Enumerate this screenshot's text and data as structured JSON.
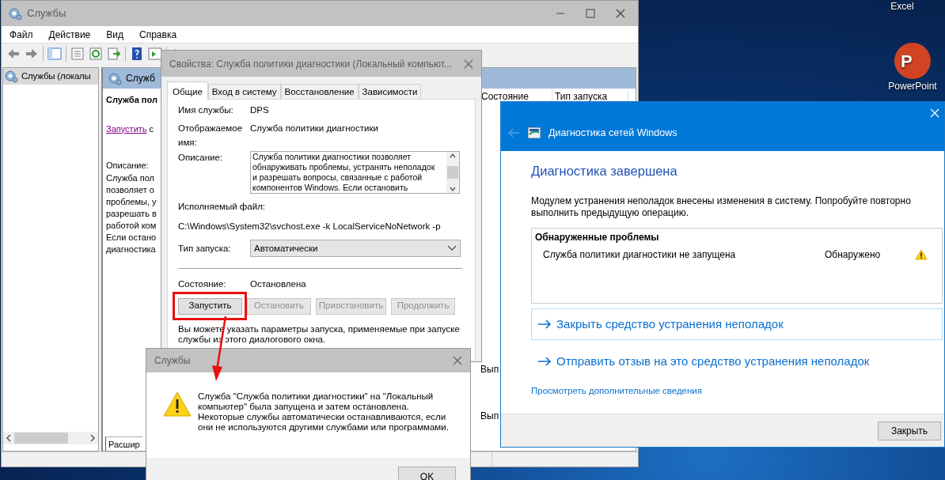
{
  "desktop": {
    "icons": [
      {
        "label": "Excel"
      },
      {
        "label": "PowerPoint",
        "logo_letter": "P"
      }
    ]
  },
  "services": {
    "title": "Службы",
    "menu": [
      "Файл",
      "Действие",
      "Вид",
      "Справка"
    ],
    "tree": [
      {
        "label": "Службы (локалы",
        "selected": true
      }
    ],
    "pane_header": "Служб",
    "service_title": "Служба пол",
    "start_link": "Запустить",
    "start_rest": "с",
    "description_label": "Описание:",
    "description_lines": [
      "Служба пол",
      "позволяет о",
      "проблемы, у",
      "разрешать в",
      "работой ком",
      "Если остано",
      "диагностика"
    ],
    "columns": [
      "Состояние",
      "Тип запуска"
    ],
    "status_cells": [
      "Вып",
      "Вып"
    ],
    "bottom_tab": "Расшир"
  },
  "properties": {
    "title": "Свойства: Служба политики диагностики (Локальный компьют...",
    "tabs": [
      {
        "label": "Общие",
        "selected": true
      },
      {
        "label": "Вход в систему",
        "selected": false
      },
      {
        "label": "Восстановление",
        "selected": false
      },
      {
        "label": "Зависимости",
        "selected": false
      }
    ],
    "service_name_label": "Имя службы:",
    "service_name": "DPS",
    "display_name_label": "Отображаемое имя:",
    "display_name": "Служба политики диагностики",
    "description_label": "Описание:",
    "description_lines": [
      "Служба политики диагностики позволяет",
      "обнаруживать проблемы, устранять неполадок",
      "и разрешать вопросы, связанные с работой",
      "компонентов Windows.  Если остановить"
    ],
    "executable_label": "Исполняемый файл:",
    "executable_path": "C:\\Windows\\System32\\svchost.exe -k LocalServiceNoNetwork -p",
    "startup_label": "Тип запуска:",
    "startup_value": "Автоматически",
    "status_label": "Состояние:",
    "status_value": "Остановлена",
    "buttons": [
      {
        "label": "Запустить",
        "disabled": false,
        "annotated": true
      },
      {
        "label": "Остановить",
        "disabled": true,
        "annotated": false
      },
      {
        "label": "Приостановить",
        "disabled": true,
        "annotated": false
      },
      {
        "label": "Продолжить",
        "disabled": true,
        "annotated": false
      }
    ],
    "hint": "Вы можете указать параметры запуска, применяемые при запуске службы из этого диалогового окна."
  },
  "message_box": {
    "title": "Службы",
    "message": "Служба \"Служба политики диагностики\" на \"Локальный компьютер\" была запущена и затем остановлена. Некоторые службы автоматически останавливаются, если они не используются другими службами или программами.",
    "button": "OK"
  },
  "diagnostics": {
    "title": "Диагностика сетей Windows",
    "heading": "Диагностика завершена",
    "message": "Модулем устранения неполадок внесены изменения в систему. Попробуйте повторно выполнить предыдущую операцию.",
    "problems": {
      "title": "Обнаруженные проблемы",
      "rows": [
        {
          "name": "Служба политики диагностики не запущена",
          "status": "Обнаружено"
        }
      ]
    },
    "options": [
      {
        "label": "Закрыть средство устранения неполадок",
        "focused": true
      },
      {
        "label": "Отправить отзыв на это средство устранения неполадок",
        "focused": false
      }
    ],
    "details_link": "Просмотреть дополнительные сведения",
    "close_button": "Закрыть"
  }
}
